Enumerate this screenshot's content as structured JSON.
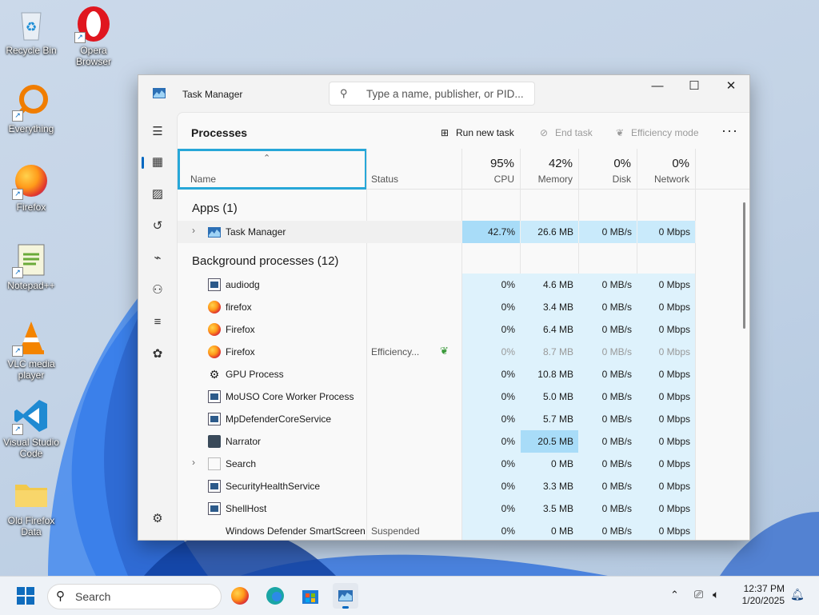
{
  "desktop": {
    "icons": [
      {
        "label": "Recycle Bin"
      },
      {
        "label": "Opera Browser"
      },
      {
        "label": "Everything"
      },
      {
        "label": "Firefox"
      },
      {
        "label": "Notepad++"
      },
      {
        "label": "VLC media player"
      },
      {
        "label": "Visual Studio Code"
      },
      {
        "label": "Old Firefox Data"
      }
    ]
  },
  "window": {
    "title": "Task Manager",
    "search_placeholder": "Type a name, publisher, or PID..."
  },
  "toolbar": {
    "page_title": "Processes",
    "run_new_task": "Run new task",
    "end_task": "End task",
    "efficiency_mode": "Efficiency mode"
  },
  "columns": {
    "name": "Name",
    "status": "Status",
    "cpu": {
      "pct": "95%",
      "label": "CPU"
    },
    "memory": {
      "pct": "42%",
      "label": "Memory"
    },
    "disk": {
      "pct": "0%",
      "label": "Disk"
    },
    "network": {
      "pct": "0%",
      "label": "Network"
    }
  },
  "groups": {
    "apps": "Apps (1)",
    "background": "Background processes (12)"
  },
  "apps": [
    {
      "name": "Task Manager",
      "cpu": "42.7%",
      "memory": "26.6 MB",
      "disk": "0 MB/s",
      "network": "0 Mbps"
    }
  ],
  "background": [
    {
      "name": "audiodg",
      "status": "",
      "cpu": "0%",
      "memory": "4.6 MB",
      "disk": "0 MB/s",
      "network": "0 Mbps"
    },
    {
      "name": "firefox",
      "status": "",
      "cpu": "0%",
      "memory": "3.4 MB",
      "disk": "0 MB/s",
      "network": "0 Mbps"
    },
    {
      "name": "Firefox",
      "status": "",
      "cpu": "0%",
      "memory": "6.4 MB",
      "disk": "0 MB/s",
      "network": "0 Mbps"
    },
    {
      "name": "Firefox",
      "status": "Efficiency...",
      "cpu": "0%",
      "memory": "8.7 MB",
      "disk": "0 MB/s",
      "network": "0 Mbps"
    },
    {
      "name": "GPU Process",
      "status": "",
      "cpu": "0%",
      "memory": "10.8 MB",
      "disk": "0 MB/s",
      "network": "0 Mbps"
    },
    {
      "name": "MoUSO Core Worker Process",
      "status": "",
      "cpu": "0%",
      "memory": "5.0 MB",
      "disk": "0 MB/s",
      "network": "0 Mbps"
    },
    {
      "name": "MpDefenderCoreService",
      "status": "",
      "cpu": "0%",
      "memory": "5.7 MB",
      "disk": "0 MB/s",
      "network": "0 Mbps"
    },
    {
      "name": "Narrator",
      "status": "",
      "cpu": "0%",
      "memory": "20.5 MB",
      "disk": "0 MB/s",
      "network": "0 Mbps"
    },
    {
      "name": "Search",
      "status": "",
      "cpu": "0%",
      "memory": "0 MB",
      "disk": "0 MB/s",
      "network": "0 Mbps"
    },
    {
      "name": "SecurityHealthService",
      "status": "",
      "cpu": "0%",
      "memory": "3.3 MB",
      "disk": "0 MB/s",
      "network": "0 Mbps"
    },
    {
      "name": "ShellHost",
      "status": "",
      "cpu": "0%",
      "memory": "3.5 MB",
      "disk": "0 MB/s",
      "network": "0 Mbps"
    },
    {
      "name": "Windows Defender SmartScreen",
      "status": "Suspended",
      "cpu": "0%",
      "memory": "0 MB",
      "disk": "0 MB/s",
      "network": "0 Mbps"
    }
  ],
  "taskbar": {
    "search_label": "Search",
    "time": "12:37 PM",
    "date": "1/20/2025"
  }
}
